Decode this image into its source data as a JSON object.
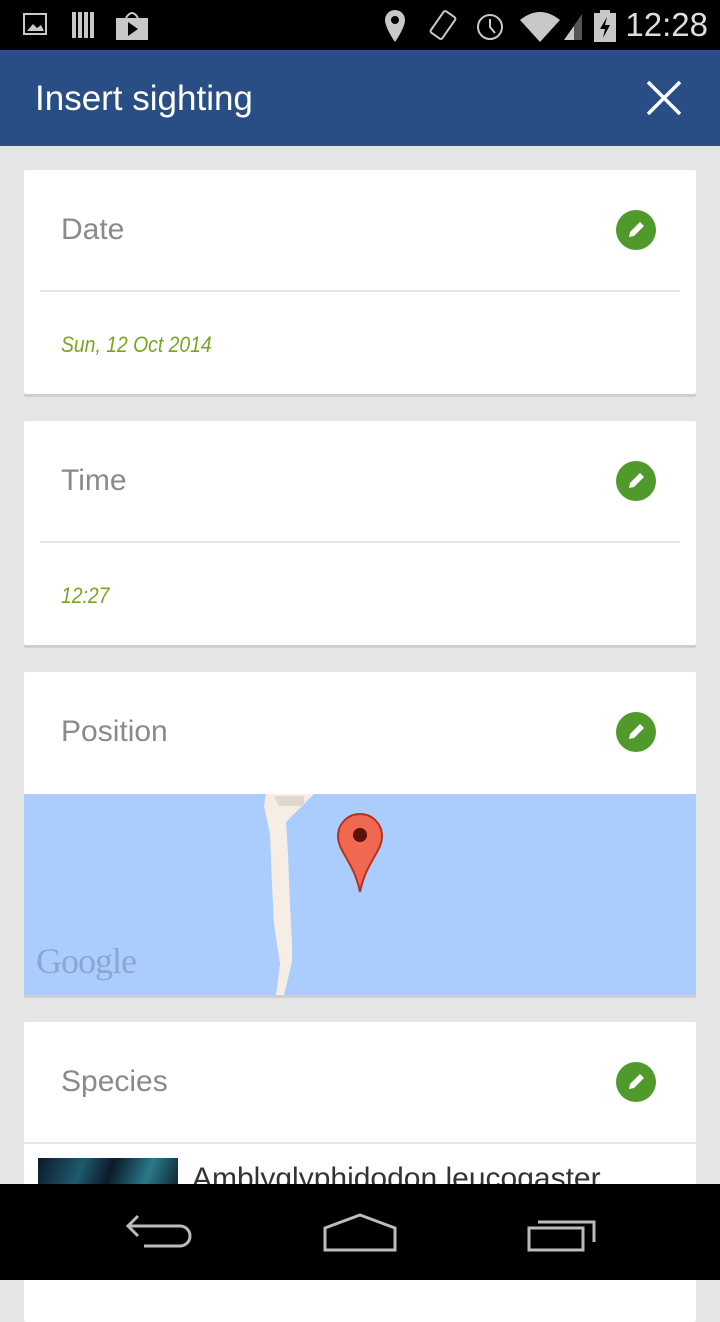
{
  "status_bar": {
    "time": "12:28",
    "icons": [
      "image-icon",
      "library-icon",
      "play-store-icon",
      "location-icon",
      "vibrate-icon",
      "alarm-icon",
      "wifi-icon",
      "signal-icon",
      "battery-charging-icon"
    ]
  },
  "app_bar": {
    "title": "Insert sighting",
    "close_icon": "close-icon"
  },
  "cards": {
    "date": {
      "label": "Date",
      "value": "Sun, 12 Oct 2014"
    },
    "time": {
      "label": "Time",
      "value": "12:27"
    },
    "position": {
      "label": "Position",
      "map_attribution": "Google"
    },
    "species": {
      "label": "Species",
      "items": [
        {
          "name": "Amblyglyphidodon leucogaster"
        }
      ]
    }
  },
  "colors": {
    "app_bar": "#284e85",
    "accent": "#4f9a2a",
    "value_text": "#7aa520",
    "map_water": "#abcdfd"
  },
  "nav_bar": {
    "icons": [
      "back-icon",
      "home-icon",
      "recents-icon"
    ]
  }
}
